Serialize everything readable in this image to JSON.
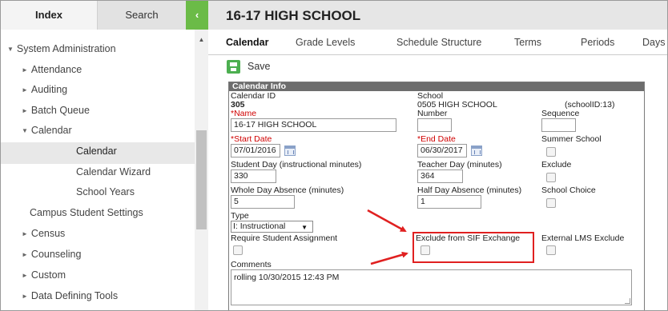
{
  "nav": {
    "tab_index": "Index",
    "tab_search": "Search",
    "collapse_glyph": "‹",
    "tree": [
      {
        "label": "System Administration",
        "toggle": "▼"
      },
      {
        "label": "Attendance",
        "toggle": "►"
      },
      {
        "label": "Auditing",
        "toggle": "►"
      },
      {
        "label": "Batch Queue",
        "toggle": "►"
      },
      {
        "label": "Calendar",
        "toggle": "▼"
      },
      {
        "label": "Calendar"
      },
      {
        "label": "Calendar Wizard"
      },
      {
        "label": "School Years"
      },
      {
        "label": "Campus Student Settings"
      },
      {
        "label": "Census",
        "toggle": "►"
      },
      {
        "label": "Counseling",
        "toggle": "►"
      },
      {
        "label": "Custom",
        "toggle": "►"
      },
      {
        "label": "Data Defining Tools",
        "toggle": "►"
      }
    ],
    "scroll_up": "▲"
  },
  "header": {
    "title": "16-17 HIGH SCHOOL",
    "tabs": [
      "Calendar",
      "Grade Levels",
      "Schedule Structure",
      "Terms",
      "Periods",
      "Days"
    ]
  },
  "toolbar": {
    "save_label": "Save",
    "save_icon": "save-icon"
  },
  "calendar_info": {
    "heading": "Calendar Info",
    "calendar_id_label": "Calendar ID",
    "calendar_id": "305",
    "school_label": "School",
    "school_value": "0505 HIGH SCHOOL",
    "school_id": "(schoolID:13)",
    "name_label": "*Name",
    "name_value": "16-17 HIGH SCHOOL",
    "number_label": "Number",
    "number_value": "",
    "sequence_label": "Sequence",
    "sequence_value": "",
    "start_date_label": "*Start Date",
    "start_date_value": "07/01/2016",
    "end_date_label": "*End Date",
    "end_date_value": "06/30/2017",
    "summer_school_label": "Summer School",
    "student_day_label": "Student Day (instructional minutes)",
    "student_day_value": "330",
    "teacher_day_label": "Teacher Day (minutes)",
    "teacher_day_value": "364",
    "exclude_label": "Exclude",
    "whole_day_label": "Whole Day Absence (minutes)",
    "whole_day_value": "5",
    "half_day_label": "Half Day Absence (minutes)",
    "half_day_value": "1",
    "school_choice_label": "School Choice",
    "type_label": "Type",
    "type_value": "I: Instructional",
    "require_assignment_label": "Require Student Assignment",
    "exclude_sif_label": "Exclude from SIF Exchange",
    "external_lms_label": "External LMS Exclude",
    "comments_label": "Comments",
    "comments_value": "rolling 10/30/2015 12:43 PM"
  },
  "colors": {
    "accent": "#6bbb47",
    "annotation": "#e02020",
    "required": "#d00000"
  }
}
